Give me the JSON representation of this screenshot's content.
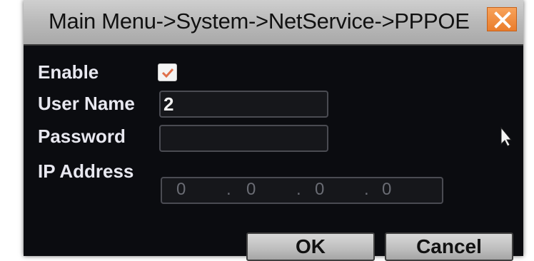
{
  "window": {
    "title": "Main Menu->System->NetService->PPPOE",
    "close_icon": "close-x-icon"
  },
  "form": {
    "enable_label": "Enable",
    "enable_checked": true,
    "username_label": "User Name",
    "username_value": "2",
    "password_label": "Password",
    "password_value": "",
    "ip_label": "IP Address",
    "ip_octets": [
      "0",
      "0",
      "0",
      "0"
    ],
    "ip_separator": "."
  },
  "buttons": {
    "ok_label": "OK",
    "cancel_label": "Cancel"
  },
  "colors": {
    "dialog_background": "#0b0c10",
    "titlebar": "#bdbdbd",
    "close_button": "#ea7d2c",
    "label_text": "#e8e8f0"
  }
}
